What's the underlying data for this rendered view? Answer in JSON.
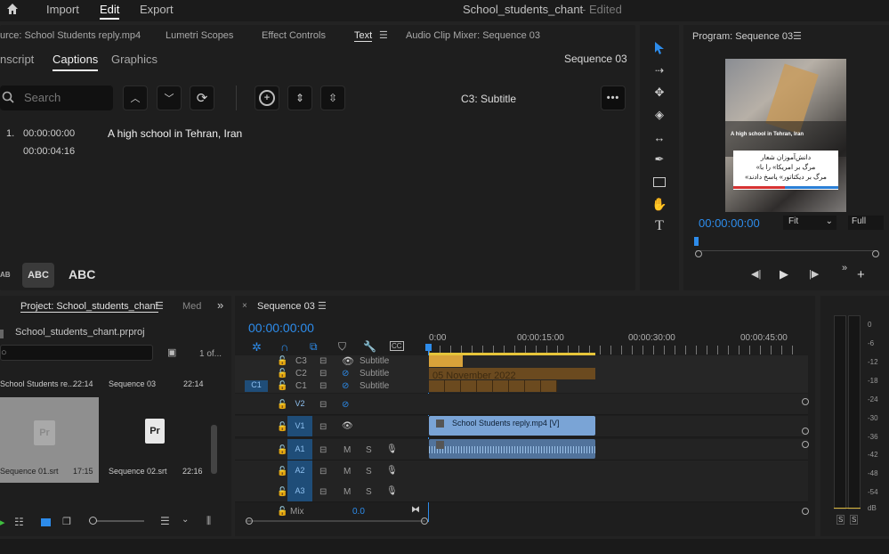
{
  "topbar": {
    "home_icon": "home-icon",
    "import": "Import",
    "edit": "Edit",
    "export": "Export",
    "project_title": "School_students_chant",
    "edited": "- Edited"
  },
  "source_tabs": {
    "source": "urce: School Students reply.mp4",
    "lumetri": "Lumetri Scopes",
    "effect": "Effect Controls",
    "text": "Text",
    "audio": "Audio Clip Mixer: Sequence 03"
  },
  "text_panel": {
    "subtabs": [
      "nscript",
      "Captions",
      "Graphics"
    ],
    "sequence": "Sequence 03",
    "search_placeholder": "Search",
    "track": "C3: Subtitle",
    "caption": {
      "index": "1.",
      "in": "00:00:00:00",
      "out": "00:00:04:16",
      "text": "A high school in Tehran, Iran"
    },
    "styles": [
      "ABC",
      "ABC",
      "ABC"
    ]
  },
  "program": {
    "title": "Program: Sequence 03",
    "timecode": "00:00:00:00",
    "fit": "Fit",
    "full": "Full",
    "overlay_en": "A high school in Tehran, Iran",
    "overlay_fa_1": "دانش‌آموزان شعار",
    "overlay_fa_2": "«مرگ بر امریکا» را با",
    "overlay_fa_3": "«مرگ بر دیکتاتور» پاسخ دادند"
  },
  "project": {
    "tab": "Project: School_students_chant",
    "tab2": "Med",
    "file": "School_students_chant.prproj",
    "count": "1 of...",
    "items": [
      {
        "name": "School Students re...",
        "dur": "22:14"
      },
      {
        "name": "Sequence 03",
        "dur": "22:14"
      },
      {
        "name": "Sequence 01.srt",
        "dur": "17:15"
      },
      {
        "name": "Sequence 02.srt",
        "dur": "22:16"
      }
    ]
  },
  "timeline": {
    "tab": "Sequence 03",
    "timecode": "00:00:00:00",
    "ruler": [
      "0:00",
      "00:00:15:00",
      "00:00:30:00",
      "00:00:45:00"
    ],
    "captions": [
      {
        "id": "C3",
        "name": "Subtitle"
      },
      {
        "id": "C2",
        "name": "Subtitle"
      },
      {
        "id": "C1",
        "name": "Subtitle"
      }
    ],
    "caption_overlay": "05 November 2022",
    "video": [
      {
        "id": "V2"
      },
      {
        "id": "V1",
        "clip": "School Students reply.mp4 [V]"
      }
    ],
    "audio": [
      {
        "id": "A1"
      },
      {
        "id": "A2"
      },
      {
        "id": "A3"
      }
    ],
    "m": "M",
    "s": "S",
    "mix": "Mix",
    "mix_val": "0.0"
  },
  "meter": {
    "labels": [
      "0",
      "-6",
      "-12",
      "-18",
      "-24",
      "-30",
      "-36",
      "-42",
      "-48",
      "-54",
      "dB"
    ],
    "s1": "S",
    "s2": "S"
  },
  "colors": {
    "accent": "#2d8ceb",
    "caption_clip": "#6b4a1f",
    "caption_clip_active": "#d8a23a",
    "video_clip": "#7aa4d6",
    "audio_clip": "#6d8fb6"
  }
}
